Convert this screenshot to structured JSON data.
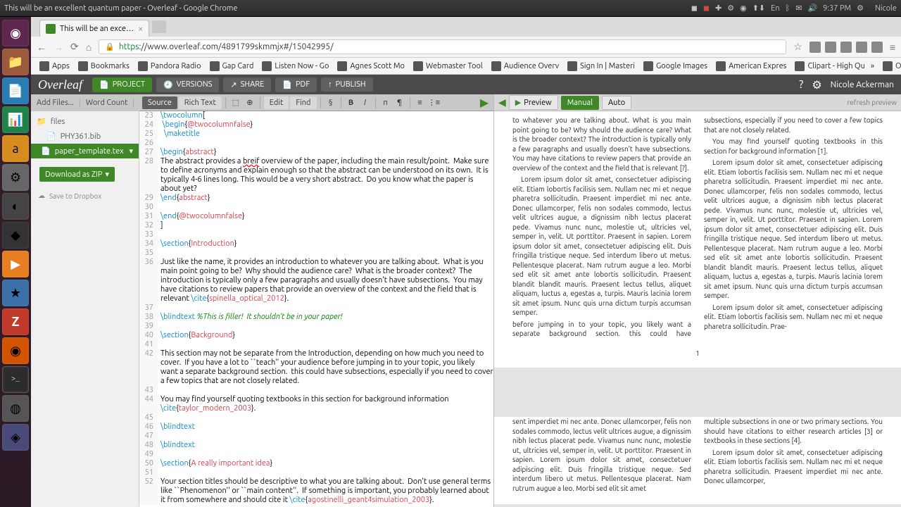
{
  "window_title": "This will be an excellent quantum paper - Overleaf - Google Chrome",
  "panel_time": "9:37 PM",
  "panel_user": "Nicole",
  "panel_lang": "En",
  "tab_title": "This will be an exce…",
  "url_https": "https",
  "url": "://www.overleaf.com/4891799skmmjx#/15042995/",
  "bookmarks": {
    "apps": "Apps",
    "bookmarks": "Bookmarks",
    "pandora": "Pandora Radio",
    "gap": "Gap Card",
    "listen": "Listen Now - Go",
    "agnes": "Agnes Scott Mo",
    "webmaster": "Webmaster Tool",
    "audience": "Audience Overv",
    "signin": "Sign In | Masteri",
    "gimages": "Google Images",
    "amex": "American Expres",
    "clipart": "Clipart - High Qu",
    "other": "Other bookmarks"
  },
  "overleaf": {
    "logo": "Overleaf",
    "project": "PROJECT",
    "versions": "VERSIONS",
    "share": "SHARE",
    "pdf": "PDF",
    "publish": "PUBLISH",
    "user": "Nicole Ackerman"
  },
  "files": {
    "add": "Add Files...",
    "wordcount": "Word Count",
    "folder": "files",
    "bib": "PHY361.bib",
    "tex": "paper_template.tex",
    "download": "Download as ZIP",
    "dropbox": "Save to Dropbox"
  },
  "editor": {
    "source": "Source",
    "rich": "Rich Text",
    "edit": "Edit",
    "find": "Find"
  },
  "code": [
    {
      "n": 23,
      "raw": "\\twocolumn["
    },
    {
      "n": 24,
      "raw": " \\begin{@twocolumnfalse}"
    },
    {
      "n": 25,
      "raw": "  \\maketitle"
    },
    {
      "n": 26,
      "raw": ""
    },
    {
      "n": 27,
      "raw": "\\begin{abstract}"
    },
    {
      "n": 28,
      "raw": "The abstract provides a breif overview of the paper, including the main result/point.  Make sure to define acronyms and explain enough so that the abstract can be understood on its own.  It is typically 4-6 lines long. This would be a very short abstract.  Do you know what the paper is about yet?"
    },
    {
      "n": 29,
      "raw": "\\end{abstract}"
    },
    {
      "n": 30,
      "raw": ""
    },
    {
      "n": 31,
      "raw": "\\end{@twocolumnfalse}"
    },
    {
      "n": 32,
      "raw": "]"
    },
    {
      "n": 33,
      "raw": ""
    },
    {
      "n": 34,
      "raw": "\\section{Introduction}"
    },
    {
      "n": 35,
      "raw": ""
    },
    {
      "n": 36,
      "raw": "Just like the name, it provides an introduction to whatever you are talking about.  What is you main point going to be?  Why should the audience care?  What is the broader context?  The introduction is typically only a few paragraphs and usually doesn't have subsections.  You may have citations to review papers that provide an overview of the context and the field that is relevant \\cite{spinella_optical_2012}."
    },
    {
      "n": 37,
      "raw": ""
    },
    {
      "n": 38,
      "raw": "\\blindtext %This is filler!  It shouldn't be in your paper!"
    },
    {
      "n": 39,
      "raw": ""
    },
    {
      "n": 40,
      "raw": "\\section{Background}"
    },
    {
      "n": 41,
      "raw": ""
    },
    {
      "n": 42,
      "raw": "This section may not be separate from the Introduction, depending on how much you need to cover.  If you have a lot to ``teach'' your audience before jumping in to your topic, you likely want a separate background section.  this could have subsections, especially if you need to cover a few topics that are not closely related."
    },
    {
      "n": 43,
      "raw": ""
    },
    {
      "n": 44,
      "raw": "You may find yourself quoting textbooks in this section for background information \\cite{taylor_modern_2003}."
    },
    {
      "n": 45,
      "raw": ""
    },
    {
      "n": 46,
      "raw": "\\blindtext"
    },
    {
      "n": 47,
      "raw": ""
    },
    {
      "n": 48,
      "raw": "\\blindtext"
    },
    {
      "n": 49,
      "raw": ""
    },
    {
      "n": 50,
      "raw": "\\section{A really important idea}"
    },
    {
      "n": 51,
      "raw": ""
    },
    {
      "n": 52,
      "raw": "Your section titles should be descriptive to what you are talking about.  Don't use general terms like ``Phenomenon'' or ``main content''.  If something is important, you probably learned about it from somewhere and should cite it \\cite{agostinelli_geant4simulation_2003}."
    }
  ],
  "preview": {
    "preview_btn": "Preview",
    "manual": "Manual",
    "auto": "Auto",
    "refresh": "refresh preview",
    "pagenum": "1",
    "p1": "to whatever you are talking about. What is you main point going to be? Why should the audience care? What is the broader context? The introduction is typically only a few paragraphs and usually doesn't have subsections. You may have citations to review papers that provide an overview of the context and the field that is relevant [?].",
    "p1b": "before jumping in to your topic, you likely want a separate background section. this could have subsections, especially if you need to cover a few topics that are not closely related.",
    "p1c": "You may find yourself quoting textbooks in this section for background information [1].",
    "p2": "Lorem ipsum dolor sit amet, consectetuer adipiscing elit. Etiam lobortis facilisis sem. Nullam nec mi et neque pharetra sollicitudin. Praesent imperdiet mi nec ante. Donec ullamcorper, felis non sodales commodo, lectus velit ultrices augue, a dignissim nibh lectus placerat pede. Vivamus nunc nunc, molestie ut, ultricies vel, semper in, velit. Ut porttitor. Praesent in sapien. Lorem ipsum dolor sit amet, consectetuer adipiscing elit. Duis fringilla tristique neque. Sed interdum libero ut metus. Pellentesque placerat. Nam rutrum augue a leo. Morbi sed elit sit amet ante lobortis sollicitudin. Praesent blandit blandit mauris. Praesent lectus tellus, aliquet aliquam, luctus a, egestas a, turpis. Mauris lacinia lorem sit amet ipsum. Nunc quis urna dictum turpis accumsan semper.",
    "p3": "Lorem ipsum dolor sit amet, consectetuer adipiscing elit. Etiam lobortis facilisis sem. Nullam nec mi et neque pharetra sollicitudin. Praesent imperdiet mi nec ante. Donec ullamcorper, felis non sodales commodo, lectus velit ultrices augue, a dignissim nibh lectus placerat pede. Vivamus nunc nunc, molestie ut, ultricies vel, semper in, velit. Ut porttitor. Praesent in sapien. Lorem ipsum dolor sit amet, consectetuer adipiscing elit. Duis fringilla tristique neque. Sed interdum libero ut metus. Pellentesque placerat. Nam rutrum augue a leo. Morbi sed elit sit amet ante lobortis sollicitudin. Praesent blandit blandit mauris. Praesent lectus tellus, aliquet aliquam, luctus a, egestas a, turpis. Mauris lacinia lorem sit amet ipsum. Nunc quis urna dictum turpis accumsan semper.",
    "p4": "Lorem ipsum dolor sit amet, consectetuer adipiscing elit. Etiam lobortis facilisis sem. Nullam nec mi et neque pharetra sollicitudin. Prae-",
    "p5a": "sent imperdiet mi nec ante. Donec ullamcorper, felis non sodales commodo, lectus velit ultrices augue, a dignissim nibh lectus placerat pede. Vivamus nunc nunc, molestie ut, ultricies vel, semper in, velit. Ut porttitor. Praesent in sapien. Lorem ipsum dolor sit amet, consectetuer adipiscing elit. Duis fringilla tristique neque. Sed interdum libero ut metus. Pellentesque placerat. Nam rutrum augue a leo. Morbi sed elit sit amet",
    "p5b": "multiple subsections in one or two primary sections. You should have citations to either research articles [3] or textbooks in these sections [4].",
    "p5c": "Lorem ipsum dolor sit amet, consectetuer adipiscing elit. Etiam lobortis facilisis sem. Nullam nec mi et neque pharetra sollicitudin. Praesent imperdiet mi nec ante. Donec ullamcorper,"
  }
}
